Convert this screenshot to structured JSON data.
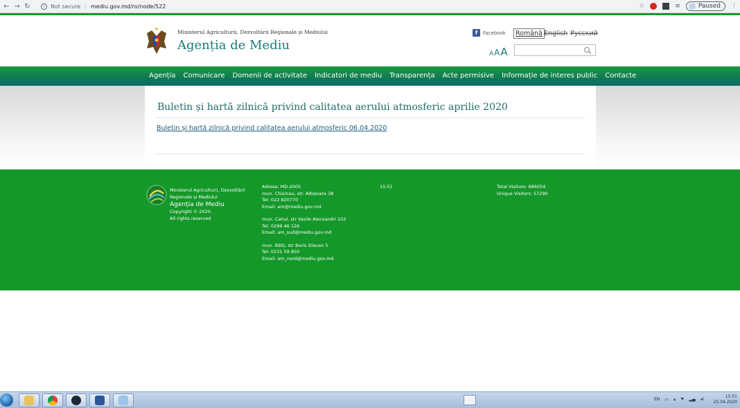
{
  "browser": {
    "security": "Not secure",
    "url": "mediu.gov.md/ro/node/522",
    "profile_status": "Paused"
  },
  "header": {
    "ministry": "Ministerul Agriculturii, Dezvoltării Regionale și Mediului",
    "agency": "Agenția de Mediu",
    "facebook": "Facebook",
    "languages": [
      "Română",
      "English",
      "Русский"
    ],
    "font_size_control": [
      "A",
      "A",
      "A"
    ],
    "search_placeholder": ""
  },
  "nav": {
    "items": [
      "Agenția",
      "Comunicare",
      "Domenii de activitate",
      "Indicatori de mediu",
      "Transparența",
      "Acte permisive",
      "Informație de interes public",
      "Contacte"
    ]
  },
  "content": {
    "title": "Buletin și hartă zilnică privind calitatea aerului atmosferic aprilie 2020",
    "link": "Buletin și hartă zilnică privind calitatea aerului atmosferic 06.04.2020"
  },
  "footer": {
    "org_line1": "Ministerul Agriculturii, Dezvoltării",
    "org_line2": "Regionale și Mediului",
    "org_name": "Agenția de Mediu",
    "copyright": "Copyright © 2020.",
    "rights": "All rights reserved",
    "address_blocks": [
      [
        "Adresa: MD-2005",
        "mun. Chisinau, str. Albișoara 38",
        "Tel: 022 820770",
        "Email: am@mediu.gov.md"
      ],
      [
        "mun. Cahul, str Vasile Alecsandri 102",
        "Tel: 0299 46 126",
        "Email: am_sud@mediu.gov.md"
      ],
      [
        "mun. Bălți, str Boris Glavan 5",
        "Tel: 0231 59 803",
        "Email: am_nord@mediu.gov.md"
      ]
    ],
    "time": "15:51",
    "total_visitors": "Total Visitors: 686054",
    "unique_visitors": "Unique Visitors: 57290"
  },
  "taskbar": {
    "language": "EN",
    "time": "15:51",
    "date": "25.04.2020"
  },
  "colors": {
    "green": "#15982a",
    "teal": "#1c7a7a"
  }
}
